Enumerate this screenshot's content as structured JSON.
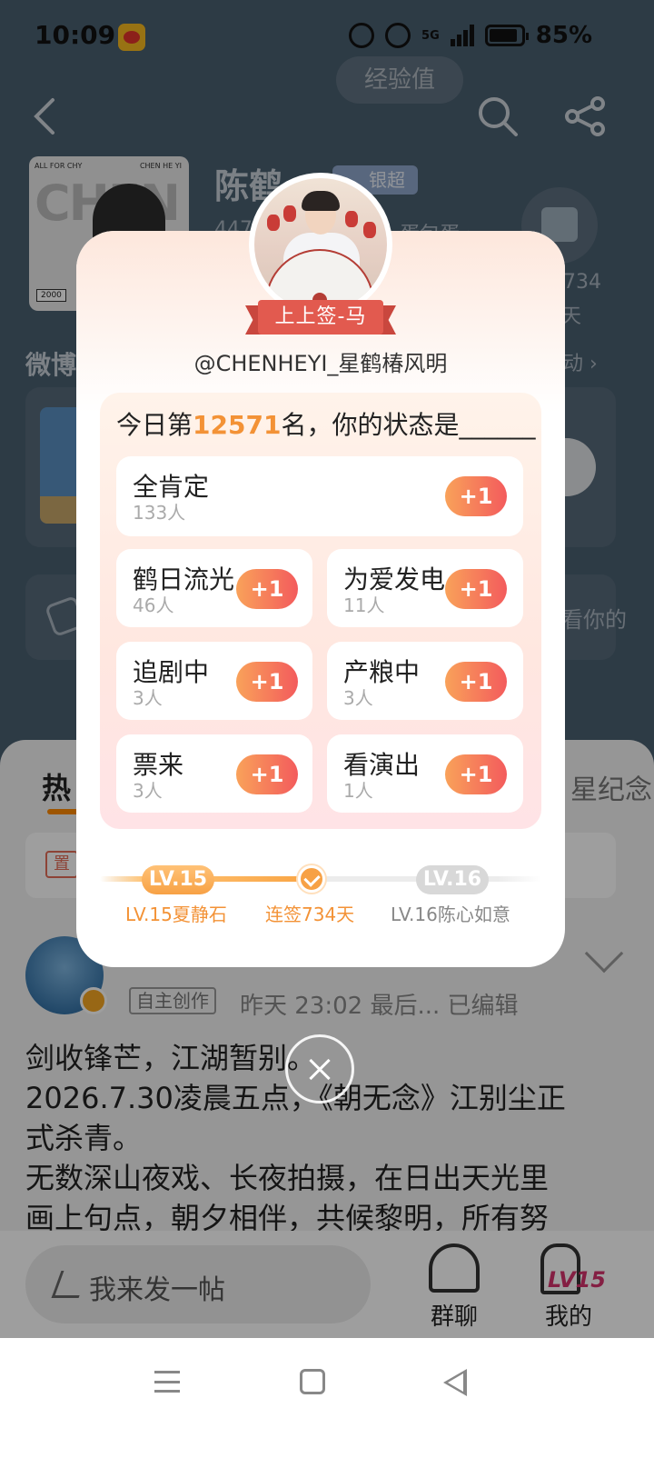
{
  "status_bar": {
    "time": "10:09",
    "network": "5G",
    "battery": "85%"
  },
  "profile": {
    "exp_label": "经验值",
    "cover_left": "ALL FOR CHY",
    "cover_right": "CHEN HE YI",
    "cover_big": "CHEN",
    "cover_year": "2000",
    "name": "陈鹤",
    "silver_tag": "银超",
    "fans": "447",
    "tan": "蛋包蛋 ›",
    "days_num": "734",
    "days_unit": "天",
    "weibo_section": "微博",
    "more_active": "动 ›",
    "post_hint": "看你的"
  },
  "feed": {
    "tab_hot": "热",
    "tab_star": "星纪念",
    "pin_tag": "置",
    "post_tag": "自主创作",
    "post_meta": "昨天 23:02 最后... 已编辑",
    "post_lines": [
      "剑收锋芒，江湖暂别。",
      "2026.7.30凌晨五点，《朝无念》江别尘正",
      "式杀青。",
      "无数深山夜戏、长夜拍摄，在日出天光里",
      "画上句点，朝夕相伴，共候黎明，所有努"
    ]
  },
  "bottom": {
    "compose": "我来发一帖",
    "group": "群聊",
    "mine": "我的",
    "mine_level": "LV15"
  },
  "modal": {
    "badge": "上上签-马",
    "handle": "@CHENHEYI_星鹤椿风明",
    "question_prefix": "今日第",
    "rank": "12571",
    "question_suffix": "名，你的状态是______",
    "plus_label": "+1",
    "options": [
      {
        "label": "全肯定",
        "count": "133人"
      },
      {
        "label": "鹤日流光",
        "count": "46人"
      },
      {
        "label": "为爱发电",
        "count": "11人"
      },
      {
        "label": "追剧中",
        "count": "3人"
      },
      {
        "label": "产粮中",
        "count": "3人"
      },
      {
        "label": "票来",
        "count": "3人"
      },
      {
        "label": "看演出",
        "count": "1人"
      }
    ],
    "level": {
      "current_badge": "LV.15",
      "next_badge": "LV.16",
      "current_label": "LV.15夏静石",
      "streak_label": "连签734天",
      "next_label": "LV.16陈心如意",
      "progress": 0.5
    }
  },
  "colors": {
    "accent": "#f39236",
    "plus_start": "#f9a25a",
    "plus_end": "#f35b5c",
    "ribbon": "#e25a4f"
  }
}
